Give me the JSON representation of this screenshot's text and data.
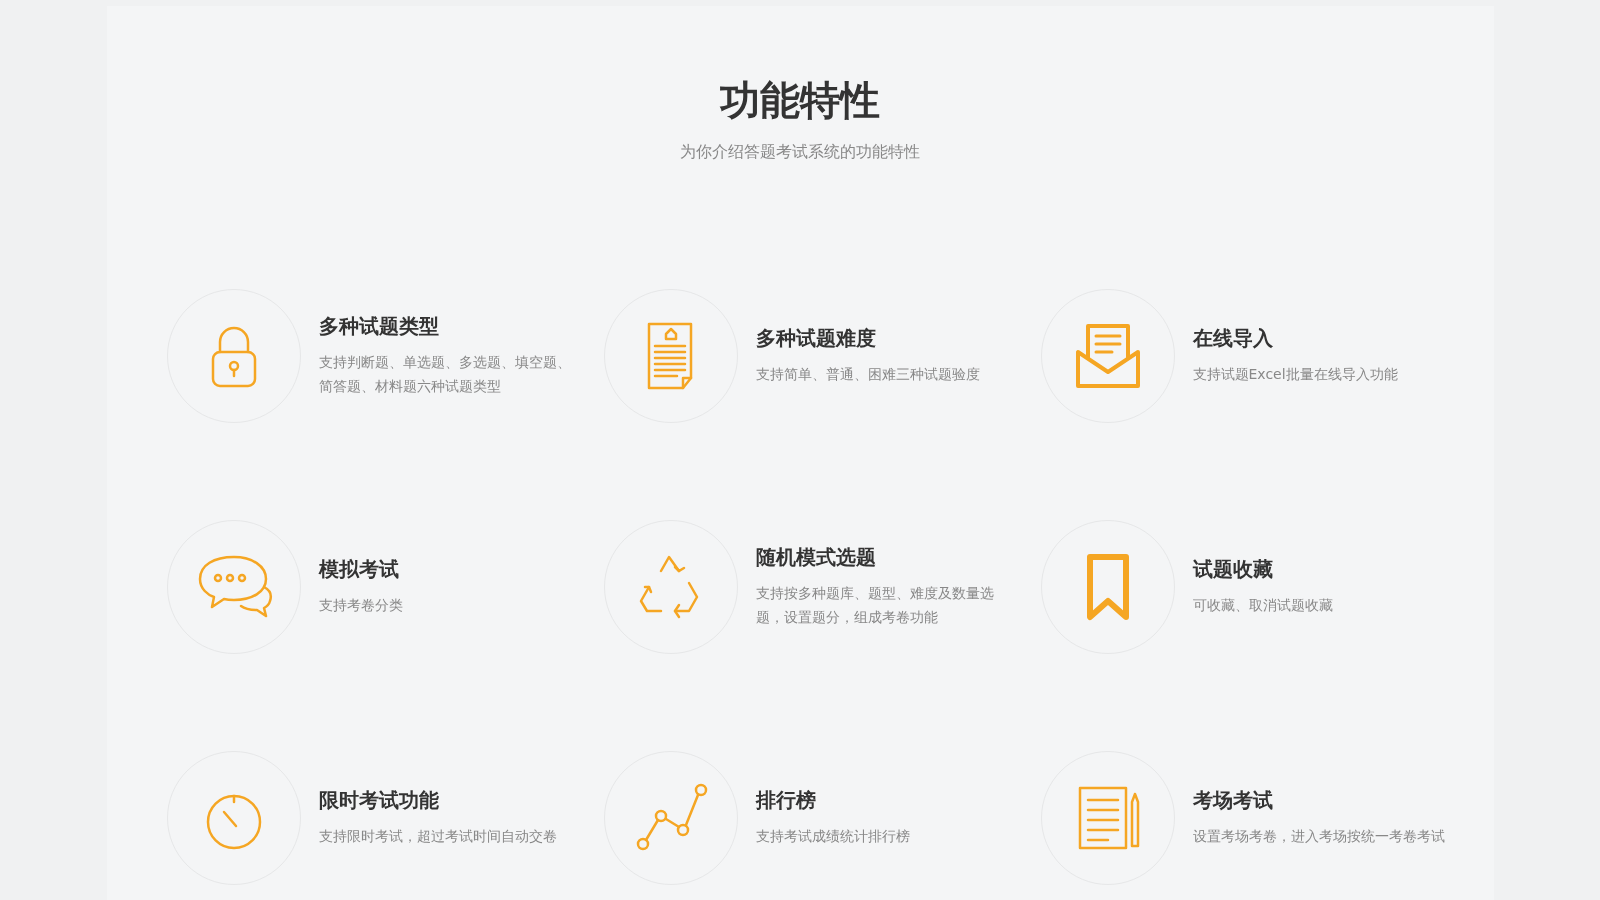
{
  "title": "功能特性",
  "subtitle": "为你介绍答题考试系统的功能特性",
  "features": [
    {
      "title": "多种试题类型",
      "description": "支持判断题、单选题、多选题、填空题、简答题、材料题六种试题类型"
    },
    {
      "title": "多种试题难度",
      "description": "支持简单、普通、困难三种试题验度"
    },
    {
      "title": "在线导入",
      "description": "支持试题Excel批量在线导入功能"
    },
    {
      "title": "模拟考试",
      "description": "支持考卷分类"
    },
    {
      "title": "随机模式选题",
      "description": "支持按多种题库、题型、难度及数量选题，设置题分，组成考卷功能"
    },
    {
      "title": "试题收藏",
      "description": "可收藏、取消试题收藏"
    },
    {
      "title": "限时考试功能",
      "description": "支持限时考试，超过考试时间自动交卷"
    },
    {
      "title": "排行榜",
      "description": "支持考试成绩统计排行榜"
    },
    {
      "title": "考场考试",
      "description": "设置考场考卷，进入考场按统一考卷考试"
    }
  ]
}
